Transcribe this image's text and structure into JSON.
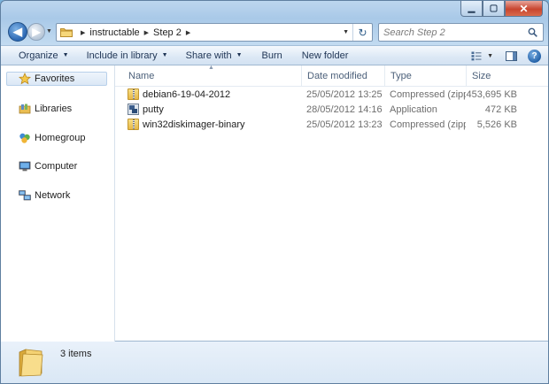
{
  "window": {
    "caption_buttons": {
      "minimize": "▁",
      "maximize": "▢",
      "close": "✕"
    }
  },
  "nav": {
    "back_glyph": "◀",
    "forward_glyph": "▶",
    "breadcrumbs": [
      "instructable",
      "Step 2"
    ],
    "refresh_glyph": "↻"
  },
  "search": {
    "placeholder": "Search Step 2"
  },
  "commands": {
    "organize": "Organize",
    "include_in_library": "Include in library",
    "share_with": "Share with",
    "burn": "Burn",
    "new_folder": "New folder",
    "help_glyph": "?"
  },
  "sidebar": {
    "items": [
      {
        "label": "Favorites",
        "icon": "star-icon"
      },
      {
        "label": "Libraries",
        "icon": "libraries-icon"
      },
      {
        "label": "Homegroup",
        "icon": "homegroup-icon"
      },
      {
        "label": "Computer",
        "icon": "computer-icon"
      },
      {
        "label": "Network",
        "icon": "network-icon"
      }
    ]
  },
  "columns": {
    "name": "Name",
    "date_modified": "Date modified",
    "type": "Type",
    "size": "Size"
  },
  "files": [
    {
      "name": "debian6-19-04-2012",
      "date": "25/05/2012 13:25",
      "type": "Compressed (zipp...",
      "size": "453,695 KB",
      "icon": "zip-folder-icon"
    },
    {
      "name": "putty",
      "date": "28/05/2012 14:16",
      "type": "Application",
      "size": "472 KB",
      "icon": "application-icon"
    },
    {
      "name": "win32diskimager-binary",
      "date": "25/05/2012 13:23",
      "type": "Compressed (zipp...",
      "size": "5,526 KB",
      "icon": "zip-folder-icon"
    }
  ],
  "details": {
    "item_count": "3 items"
  },
  "colors": {
    "accent": "#2b67b3",
    "close": "#c8452f",
    "folder": "#e7b847"
  }
}
